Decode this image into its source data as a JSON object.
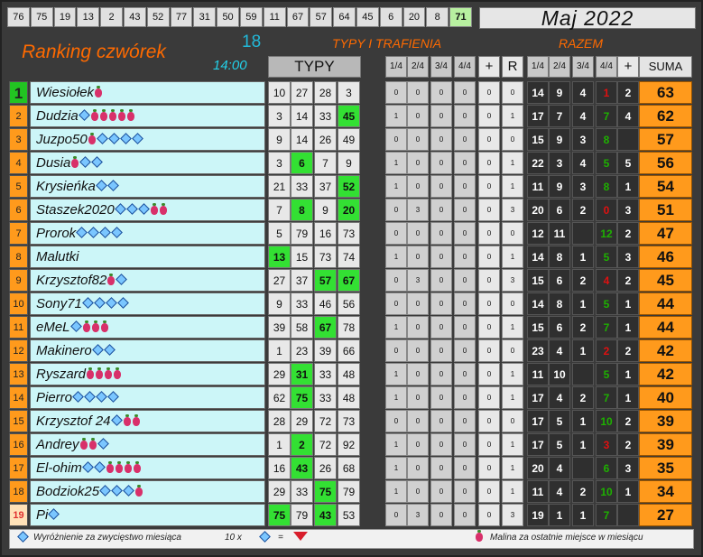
{
  "top_numbers": [
    "76",
    "75",
    "19",
    "13",
    "2",
    "43",
    "52",
    "77",
    "31",
    "50",
    "59",
    "11",
    "67",
    "57",
    "64",
    "45",
    "6",
    "20",
    "8",
    "71"
  ],
  "highlight_index": 19,
  "month": "Maj 2022",
  "title": "Ranking czwórek",
  "count": "18",
  "time": "14:00",
  "typy_label": "TYPY",
  "typy_trafienia_label": "TYPY I TRAFIENIA",
  "razem_label": "RAZEM",
  "stat_headers": [
    "1/4",
    "2/4",
    "3/4",
    "4/4",
    "+",
    "R"
  ],
  "razem_headers": [
    "1/4",
    "2/4",
    "3/4",
    "4/4",
    "+"
  ],
  "suma_label": "SUMA",
  "rows": [
    {
      "rank": "1",
      "name": "Wiesiołek",
      "icons": "b",
      "picks": [
        "10",
        "27",
        "28",
        "3"
      ],
      "wins": [],
      "stats": [
        "0",
        "0",
        "0",
        "0",
        "0",
        "0"
      ],
      "razem": [
        "14",
        "9",
        "4",
        "1",
        "2"
      ],
      "suma": "63"
    },
    {
      "rank": "2",
      "name": "Dudzia",
      "icons": "dbbbbb",
      "picks": [
        "3",
        "14",
        "33",
        "45"
      ],
      "wins": [
        3
      ],
      "stats": [
        "1",
        "0",
        "0",
        "0",
        "0",
        "1"
      ],
      "razem": [
        "17",
        "7",
        "4",
        "7",
        "4"
      ],
      "suma": "62"
    },
    {
      "rank": "3",
      "name": "Juzpo50",
      "icons": "bdddd",
      "picks": [
        "9",
        "14",
        "26",
        "49"
      ],
      "wins": [],
      "stats": [
        "0",
        "0",
        "0",
        "0",
        "0",
        "0"
      ],
      "razem": [
        "15",
        "9",
        "3",
        "8",
        ""
      ],
      "suma": "57"
    },
    {
      "rank": "4",
      "name": "Dusia",
      "icons": "bdd",
      "picks": [
        "3",
        "6",
        "7",
        "9"
      ],
      "wins": [
        1
      ],
      "stats": [
        "1",
        "0",
        "0",
        "0",
        "0",
        "1"
      ],
      "razem": [
        "22",
        "3",
        "4",
        "5",
        "5"
      ],
      "suma": "56"
    },
    {
      "rank": "5",
      "name": "Krysieńka",
      "icons": "dd",
      "picks": [
        "21",
        "33",
        "37",
        "52"
      ],
      "wins": [
        3
      ],
      "stats": [
        "1",
        "0",
        "0",
        "0",
        "0",
        "1"
      ],
      "razem": [
        "11",
        "9",
        "3",
        "8",
        "1"
      ],
      "suma": "54"
    },
    {
      "rank": "6",
      "name": "Staszek2020",
      "icons": "dddbb",
      "picks": [
        "7",
        "8",
        "9",
        "20"
      ],
      "wins": [
        1,
        3
      ],
      "stats": [
        "0",
        "3",
        "0",
        "0",
        "0",
        "3"
      ],
      "razem": [
        "20",
        "6",
        "2",
        "0",
        "3"
      ],
      "suma": "51"
    },
    {
      "rank": "7",
      "name": "Prorok",
      "icons": "dddd",
      "picks": [
        "5",
        "79",
        "16",
        "73"
      ],
      "wins": [],
      "stats": [
        "0",
        "0",
        "0",
        "0",
        "0",
        "0"
      ],
      "razem": [
        "12",
        "11",
        "",
        "12",
        "2"
      ],
      "suma": "47"
    },
    {
      "rank": "8",
      "name": "Malutki",
      "icons": "",
      "picks": [
        "13",
        "15",
        "73",
        "74"
      ],
      "wins": [
        0
      ],
      "stats": [
        "1",
        "0",
        "0",
        "0",
        "0",
        "1"
      ],
      "razem": [
        "14",
        "8",
        "1",
        "5",
        "3"
      ],
      "suma": "46"
    },
    {
      "rank": "9",
      "name": "Krzysztof82",
      "icons": "bd",
      "picks": [
        "27",
        "37",
        "57",
        "67"
      ],
      "wins": [
        2,
        3
      ],
      "stats": [
        "0",
        "3",
        "0",
        "0",
        "0",
        "3"
      ],
      "razem": [
        "15",
        "6",
        "2",
        "4",
        "2"
      ],
      "suma": "45"
    },
    {
      "rank": "10",
      "name": "Sony71",
      "icons": "dddd",
      "picks": [
        "9",
        "33",
        "46",
        "56"
      ],
      "wins": [],
      "stats": [
        "0",
        "0",
        "0",
        "0",
        "0",
        "0"
      ],
      "razem": [
        "14",
        "8",
        "1",
        "5",
        "1"
      ],
      "suma": "44"
    },
    {
      "rank": "11",
      "name": "eMeL",
      "icons": "dbbb",
      "picks": [
        "39",
        "58",
        "67",
        "78"
      ],
      "wins": [
        2
      ],
      "stats": [
        "1",
        "0",
        "0",
        "0",
        "0",
        "1"
      ],
      "razem": [
        "15",
        "6",
        "2",
        "7",
        "1"
      ],
      "suma": "44"
    },
    {
      "rank": "12",
      "name": "Makinero",
      "icons": "dd",
      "picks": [
        "1",
        "23",
        "39",
        "66"
      ],
      "wins": [],
      "stats": [
        "0",
        "0",
        "0",
        "0",
        "0",
        "0"
      ],
      "razem": [
        "23",
        "4",
        "1",
        "2",
        "2"
      ],
      "suma": "42"
    },
    {
      "rank": "13",
      "name": "Ryszard",
      "icons": "bbbb",
      "picks": [
        "29",
        "31",
        "33",
        "48"
      ],
      "wins": [
        1
      ],
      "stats": [
        "1",
        "0",
        "0",
        "0",
        "0",
        "1"
      ],
      "razem": [
        "11",
        "10",
        "",
        "5",
        "1"
      ],
      "suma": "42"
    },
    {
      "rank": "14",
      "name": "Pierro",
      "icons": "dddd",
      "picks": [
        "62",
        "75",
        "33",
        "48"
      ],
      "wins": [
        1
      ],
      "stats": [
        "1",
        "0",
        "0",
        "0",
        "0",
        "1"
      ],
      "razem": [
        "17",
        "4",
        "2",
        "7",
        "1"
      ],
      "suma": "40"
    },
    {
      "rank": "15",
      "name": "Krzysztof 24",
      "icons": "dbb",
      "picks": [
        "28",
        "29",
        "72",
        "73"
      ],
      "wins": [],
      "stats": [
        "0",
        "0",
        "0",
        "0",
        "0",
        "0"
      ],
      "razem": [
        "17",
        "5",
        "1",
        "10",
        "2"
      ],
      "suma": "39"
    },
    {
      "rank": "16",
      "name": "Andrey",
      "icons": "bbd",
      "picks": [
        "1",
        "2",
        "72",
        "92"
      ],
      "wins": [
        1
      ],
      "stats": [
        "1",
        "0",
        "0",
        "0",
        "0",
        "1"
      ],
      "razem": [
        "17",
        "5",
        "1",
        "3",
        "2"
      ],
      "suma": "39"
    },
    {
      "rank": "17",
      "name": "El-ohim",
      "icons": "ddbbbb",
      "picks": [
        "16",
        "43",
        "26",
        "68"
      ],
      "wins": [
        1
      ],
      "stats": [
        "1",
        "0",
        "0",
        "0",
        "0",
        "1"
      ],
      "razem": [
        "20",
        "4",
        "",
        "6",
        "3"
      ],
      "suma": "35"
    },
    {
      "rank": "18",
      "name": "Bodziok25",
      "icons": "dddb",
      "picks": [
        "29",
        "33",
        "75",
        "79"
      ],
      "wins": [
        2
      ],
      "stats": [
        "1",
        "0",
        "0",
        "0",
        "0",
        "1"
      ],
      "razem": [
        "11",
        "4",
        "2",
        "10",
        "1"
      ],
      "suma": "34"
    },
    {
      "rank": "19",
      "name": "Pi",
      "icons": "d",
      "picks": [
        "75",
        "79",
        "43",
        "53"
      ],
      "wins": [
        0,
        2
      ],
      "stats": [
        "0",
        "3",
        "0",
        "0",
        "0",
        "3"
      ],
      "razem": [
        "19",
        "1",
        "1",
        "7",
        ""
      ],
      "suma": "27"
    }
  ],
  "footer_left": "Wyróżnienie za zwycięstwo miesiąca",
  "footer_mid": "10 x",
  "footer_eq": "=",
  "footer_right": "Malina za ostatnie miejsce w miesiącu"
}
